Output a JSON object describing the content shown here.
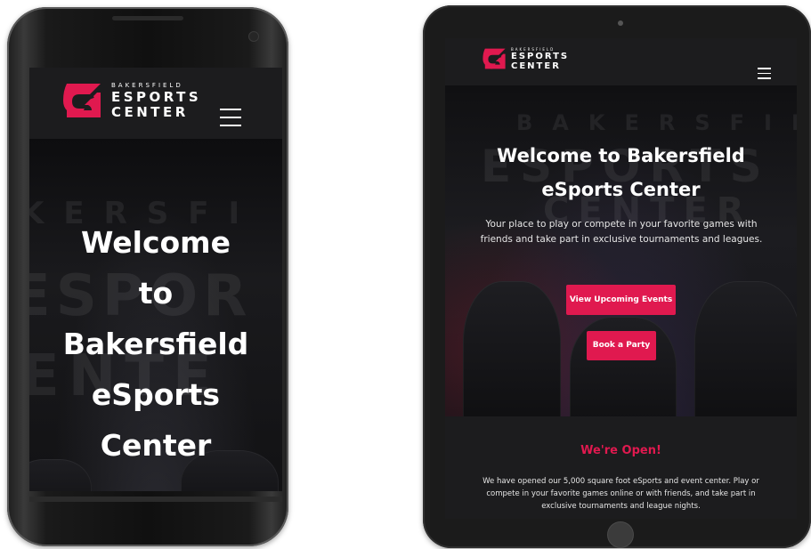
{
  "brand": {
    "logo_small": "BAKERSFIELD",
    "logo_line1": "ESPORTS",
    "logo_line2": "CENTER",
    "accent_color": "#e0194f"
  },
  "phone": {
    "hero_title_lines": [
      "Welcome",
      "to",
      "Bakersfield",
      "eSports",
      "Center"
    ],
    "menu_icon": "hamburger-menu-icon"
  },
  "tablet": {
    "hero_title_lines": [
      "Welcome to Bakersfield",
      "eSports Center"
    ],
    "hero_subtitle": "Your place to play or compete in your favorite games with friends and take part in exclusive tournaments and leagues.",
    "buttons": {
      "events": "View Upcoming Events",
      "party": "Book a Party"
    },
    "open_section": {
      "title": "We're Open!",
      "text": "We have opened our 5,000 square foot eSports and event center. Play or compete in your favorite games online or with friends, and take part in exclusive tournaments and league nights."
    },
    "menu_icon": "hamburger-menu-icon"
  }
}
